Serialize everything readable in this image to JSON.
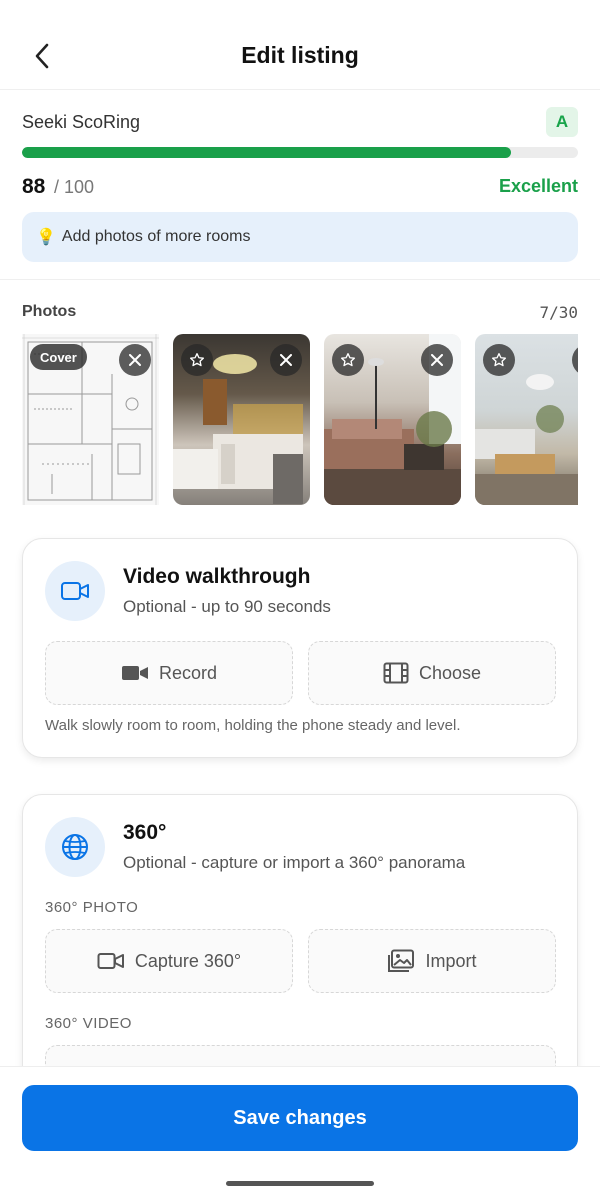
{
  "header": {
    "title": "Edit listing"
  },
  "score": {
    "title": "Seeki ScoRing",
    "grade": "A",
    "value": "88",
    "max": "/ 100",
    "progress_fraction": 0.88,
    "label": "Excellent",
    "tip": "Add photos of more rooms",
    "tip_icon": "lightbulb-icon"
  },
  "photos": {
    "label": "Photos",
    "count": "7/30",
    "cover_label": "Cover"
  },
  "video": {
    "title": "Video walkthrough",
    "subtitle": "Optional - up to 90 seconds",
    "record_label": "Record",
    "choose_label": "Choose",
    "note": "Walk slowly room to room, holding the phone steady and level."
  },
  "pano": {
    "title": "360°",
    "subtitle": "Optional - capture or import a 360° panorama",
    "photo_caption": "360° PHOTO",
    "capture_label": "Capture 360°",
    "import_label": "Import",
    "video_caption": "360° VIDEO"
  },
  "footer": {
    "save_label": "Save changes"
  },
  "colors": {
    "accent": "#0a74e6",
    "success": "#1aa04a",
    "tip_bg": "#e6f0fb"
  }
}
